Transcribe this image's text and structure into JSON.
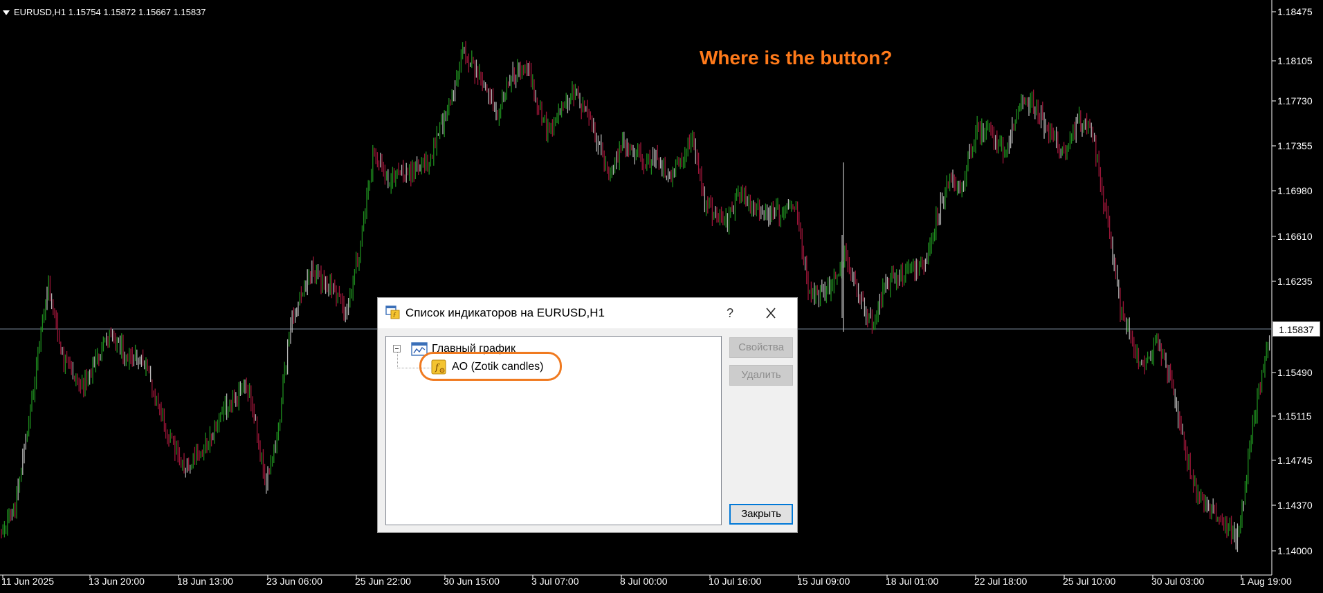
{
  "chart": {
    "symbol_info": "EURUSD,H1  1.15754 1.15872 1.15667 1.15837",
    "annotation": "Where is the button?",
    "current_price": "1.15837",
    "price_axis": [
      "1.18475",
      "1.18105",
      "1.17730",
      "1.17355",
      "1.16980",
      "1.16610",
      "1.16235",
      "1.15490",
      "1.15115",
      "1.14745",
      "1.14370",
      "1.14000"
    ],
    "time_axis": [
      "11 Jun 2025",
      "13 Jun 20:00",
      "18 Jun 13:00",
      "23 Jun 06:00",
      "25 Jun 22:00",
      "30 Jun 15:00",
      "3 Jul 07:00",
      "8 Jul 00:00",
      "10 Jul 16:00",
      "15 Jul 09:00",
      "18 Jul 01:00",
      "22 Jul 18:00",
      "25 Jul 10:00",
      "30 Jul 03:00",
      "1 Aug 19:00"
    ],
    "colors": {
      "bull": "#1e8c1e",
      "bear": "#9b1538",
      "neutral": "#b4b4b4",
      "background": "#000000",
      "annotation": "#ff7a1a"
    }
  },
  "dialog": {
    "title": "Список индикаторов на EURUSD,H1",
    "help_label": "?",
    "tree": {
      "root_label": "Главный график",
      "root_icon": "chart-window-icon",
      "child_label": "AO (Zotik candles)",
      "child_icon": "custom-indicator-icon"
    },
    "buttons": {
      "properties": "Свойства",
      "delete": "Удалить",
      "close": "Закрыть"
    }
  }
}
